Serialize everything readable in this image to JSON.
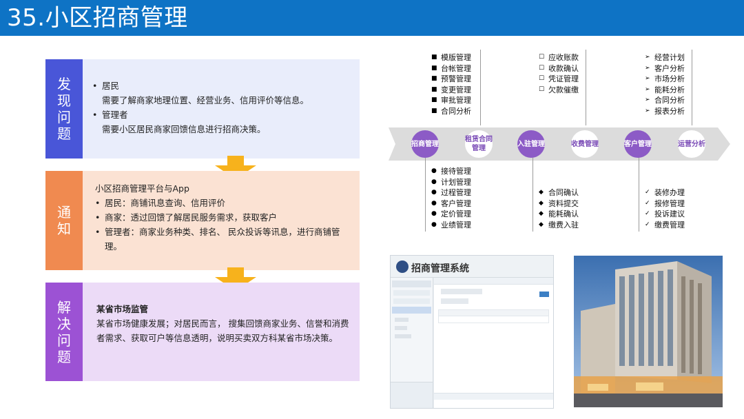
{
  "title": "35.小区招商管理",
  "blocks": [
    {
      "tag": "发现问题",
      "lines": [
        {
          "bullet": "•",
          "text": "居民"
        },
        {
          "bullet": "",
          "text": "需要了解商家地理位置、经营业务、信用评价等信息。"
        },
        {
          "bullet": "•",
          "text": "管理者"
        },
        {
          "bullet": "",
          "text": "需要小区居民商家回馈信息进行招商决策。"
        }
      ]
    },
    {
      "tag": "通知",
      "heading": "小区招商管理平台与App",
      "lines": [
        {
          "bullet": "•",
          "text": "居民：商铺讯息查询、信用评价"
        },
        {
          "bullet": "•",
          "text": "商家：透过回馈了解居民服务需求，获取客户"
        },
        {
          "bullet": "•",
          "text": "管理者：商家业务种类、排名、 民众投诉等讯息，进行商铺管理。"
        }
      ]
    },
    {
      "tag": "解决问题",
      "heading": "某省市场监管",
      "text": "某省市场健康发展；对居民而言， 搜集回馈商家业务、信誉和消费者需求、获取可户等信息透明，说明买卖双方科某省市场决策。"
    }
  ],
  "flow": {
    "nodes": [
      {
        "label": "招商管理",
        "style": "dark"
      },
      {
        "label": "租赁合同管理",
        "style": "light"
      },
      {
        "label": "入驻管理",
        "style": "dark"
      },
      {
        "label": "收费管理",
        "style": "light"
      },
      {
        "label": "客户管理",
        "style": "dark"
      },
      {
        "label": "运营分析",
        "style": "light"
      }
    ],
    "top_lists": [
      {
        "marker": "■",
        "items": [
          "模版管理",
          "台帐管理",
          "预警管理",
          "变更管理",
          "审批管理",
          "合同分析"
        ]
      },
      {
        "marker": "☐",
        "items": [
          "应收账款",
          "收款确认",
          "凭证管理",
          "欠款催缴"
        ]
      },
      {
        "marker": "➢",
        "items": [
          "经营计划",
          "客户分析",
          "市场分析",
          "能耗分析",
          "合同分析",
          "报表分析"
        ]
      }
    ],
    "bottom_lists": [
      {
        "marker": "●",
        "items": [
          "接待管理",
          "计划管理",
          "过程管理",
          "客户管理",
          "定价管理",
          "业绩管理"
        ]
      },
      {
        "marker": "◆",
        "items": [
          "合同确认",
          "资料提交",
          "能耗确认",
          "缴费入驻"
        ]
      },
      {
        "marker": "✓",
        "items": [
          "装修办理",
          "报修管理",
          "投诉建议",
          "缴费管理"
        ]
      }
    ]
  },
  "screenshot": {
    "title": "招商管理系统"
  },
  "colors": {
    "title_bar": "#0e73c5",
    "block1": "#4956d8",
    "block2": "#f08a50",
    "block3": "#9c52d4",
    "arrow": "#f7b21c",
    "flow_band": "#dcdcdc",
    "flow_dark": "#8c5bc6"
  }
}
